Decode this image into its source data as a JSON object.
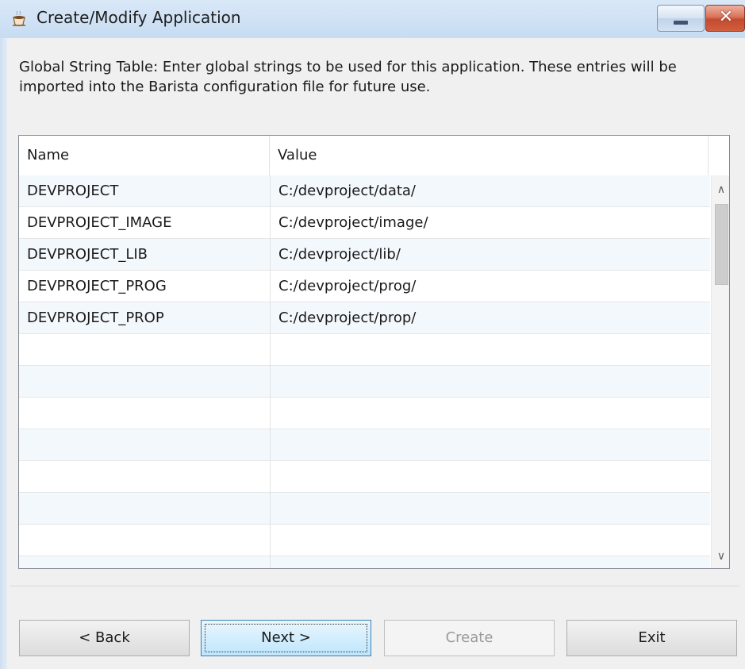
{
  "window": {
    "title": "Create/Modify Application",
    "icon": "barista-cup-icon",
    "close_glyph": "✕"
  },
  "description": "Global String Table: Enter global strings to be used for this application.  These entries will be imported into the Barista configuration file for future use.",
  "grid": {
    "columns": [
      "Name",
      "Value"
    ],
    "rows": [
      {
        "name": "DEVPROJECT",
        "value": "C:/devproject/data/"
      },
      {
        "name": "DEVPROJECT_IMAGE",
        "value": "C:/devproject/image/"
      },
      {
        "name": "DEVPROJECT_LIB",
        "value": "C:/devproject/lib/"
      },
      {
        "name": "DEVPROJECT_PROG",
        "value": "C:/devproject/prog/"
      },
      {
        "name": "DEVPROJECT_PROP",
        "value": "C:/devproject/prop/"
      }
    ],
    "scroll_up_glyph": "∧",
    "scroll_down_glyph": "∨"
  },
  "buttons": {
    "back": "< Back",
    "next": "Next >",
    "create": "Create",
    "exit": "Exit"
  }
}
